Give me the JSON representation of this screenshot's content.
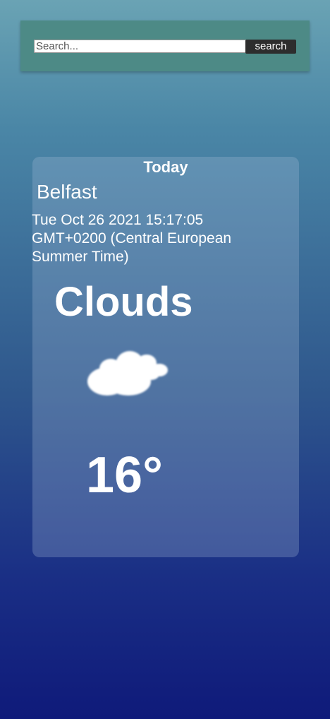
{
  "search": {
    "placeholder": "Search...",
    "value": "",
    "button_label": "search"
  },
  "weather": {
    "heading": "Today",
    "city": "Belfast",
    "datetime": "Tue Oct 26 2021 15:17:05 GMT+0200 (Central European Summer Time)",
    "condition": "Clouds",
    "icon": "cloud-icon",
    "temperature": "16°"
  }
}
